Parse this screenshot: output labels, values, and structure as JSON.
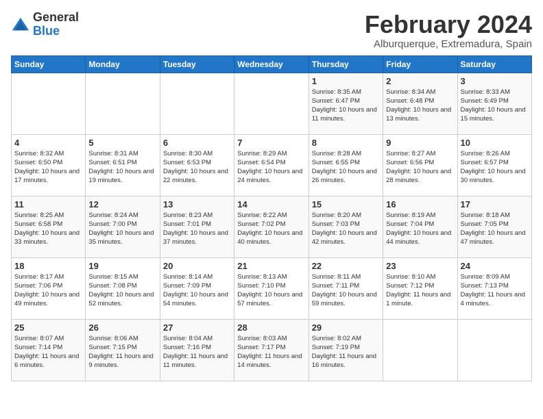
{
  "logo": {
    "general": "General",
    "blue": "Blue"
  },
  "title": "February 2024",
  "subtitle": "Alburquerque, Extremadura, Spain",
  "headers": [
    "Sunday",
    "Monday",
    "Tuesday",
    "Wednesday",
    "Thursday",
    "Friday",
    "Saturday"
  ],
  "weeks": [
    [
      {
        "day": "",
        "info": ""
      },
      {
        "day": "",
        "info": ""
      },
      {
        "day": "",
        "info": ""
      },
      {
        "day": "",
        "info": ""
      },
      {
        "day": "1",
        "info": "Sunrise: 8:35 AM\nSunset: 6:47 PM\nDaylight: 10 hours and 11 minutes."
      },
      {
        "day": "2",
        "info": "Sunrise: 8:34 AM\nSunset: 6:48 PM\nDaylight: 10 hours and 13 minutes."
      },
      {
        "day": "3",
        "info": "Sunrise: 8:33 AM\nSunset: 6:49 PM\nDaylight: 10 hours and 15 minutes."
      }
    ],
    [
      {
        "day": "4",
        "info": "Sunrise: 8:32 AM\nSunset: 6:50 PM\nDaylight: 10 hours and 17 minutes."
      },
      {
        "day": "5",
        "info": "Sunrise: 8:31 AM\nSunset: 6:51 PM\nDaylight: 10 hours and 19 minutes."
      },
      {
        "day": "6",
        "info": "Sunrise: 8:30 AM\nSunset: 6:53 PM\nDaylight: 10 hours and 22 minutes."
      },
      {
        "day": "7",
        "info": "Sunrise: 8:29 AM\nSunset: 6:54 PM\nDaylight: 10 hours and 24 minutes."
      },
      {
        "day": "8",
        "info": "Sunrise: 8:28 AM\nSunset: 6:55 PM\nDaylight: 10 hours and 26 minutes."
      },
      {
        "day": "9",
        "info": "Sunrise: 8:27 AM\nSunset: 6:56 PM\nDaylight: 10 hours and 28 minutes."
      },
      {
        "day": "10",
        "info": "Sunrise: 8:26 AM\nSunset: 6:57 PM\nDaylight: 10 hours and 30 minutes."
      }
    ],
    [
      {
        "day": "11",
        "info": "Sunrise: 8:25 AM\nSunset: 6:58 PM\nDaylight: 10 hours and 33 minutes."
      },
      {
        "day": "12",
        "info": "Sunrise: 8:24 AM\nSunset: 7:00 PM\nDaylight: 10 hours and 35 minutes."
      },
      {
        "day": "13",
        "info": "Sunrise: 8:23 AM\nSunset: 7:01 PM\nDaylight: 10 hours and 37 minutes."
      },
      {
        "day": "14",
        "info": "Sunrise: 8:22 AM\nSunset: 7:02 PM\nDaylight: 10 hours and 40 minutes."
      },
      {
        "day": "15",
        "info": "Sunrise: 8:20 AM\nSunset: 7:03 PM\nDaylight: 10 hours and 42 minutes."
      },
      {
        "day": "16",
        "info": "Sunrise: 8:19 AM\nSunset: 7:04 PM\nDaylight: 10 hours and 44 minutes."
      },
      {
        "day": "17",
        "info": "Sunrise: 8:18 AM\nSunset: 7:05 PM\nDaylight: 10 hours and 47 minutes."
      }
    ],
    [
      {
        "day": "18",
        "info": "Sunrise: 8:17 AM\nSunset: 7:06 PM\nDaylight: 10 hours and 49 minutes."
      },
      {
        "day": "19",
        "info": "Sunrise: 8:15 AM\nSunset: 7:08 PM\nDaylight: 10 hours and 52 minutes."
      },
      {
        "day": "20",
        "info": "Sunrise: 8:14 AM\nSunset: 7:09 PM\nDaylight: 10 hours and 54 minutes."
      },
      {
        "day": "21",
        "info": "Sunrise: 8:13 AM\nSunset: 7:10 PM\nDaylight: 10 hours and 57 minutes."
      },
      {
        "day": "22",
        "info": "Sunrise: 8:11 AM\nSunset: 7:11 PM\nDaylight: 10 hours and 59 minutes."
      },
      {
        "day": "23",
        "info": "Sunrise: 8:10 AM\nSunset: 7:12 PM\nDaylight: 11 hours and 1 minute."
      },
      {
        "day": "24",
        "info": "Sunrise: 8:09 AM\nSunset: 7:13 PM\nDaylight: 11 hours and 4 minutes."
      }
    ],
    [
      {
        "day": "25",
        "info": "Sunrise: 8:07 AM\nSunset: 7:14 PM\nDaylight: 11 hours and 6 minutes."
      },
      {
        "day": "26",
        "info": "Sunrise: 8:06 AM\nSunset: 7:15 PM\nDaylight: 11 hours and 9 minutes."
      },
      {
        "day": "27",
        "info": "Sunrise: 8:04 AM\nSunset: 7:16 PM\nDaylight: 11 hours and 11 minutes."
      },
      {
        "day": "28",
        "info": "Sunrise: 8:03 AM\nSunset: 7:17 PM\nDaylight: 11 hours and 14 minutes."
      },
      {
        "day": "29",
        "info": "Sunrise: 8:02 AM\nSunset: 7:19 PM\nDaylight: 11 hours and 16 minutes."
      },
      {
        "day": "",
        "info": ""
      },
      {
        "day": "",
        "info": ""
      }
    ]
  ]
}
